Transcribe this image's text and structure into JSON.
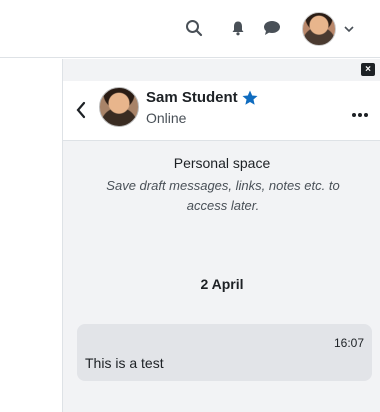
{
  "colors": {
    "accent": "#0f6cbf",
    "drawer_bg": "#f2f3f5",
    "message_bg": "#e2e4e8"
  },
  "navbar": {
    "icons": [
      "search-icon",
      "bell-icon",
      "chat-icon",
      "chevron-down-icon"
    ]
  },
  "conversation": {
    "name": "Sam Student",
    "status": "Online",
    "starred": true
  },
  "personal_space": {
    "title": "Personal space",
    "description": "Save draft messages, links, notes etc. to access later."
  },
  "messages": {
    "date": "2 April",
    "items": [
      {
        "time": "16:07",
        "text": "This is a test"
      }
    ]
  }
}
